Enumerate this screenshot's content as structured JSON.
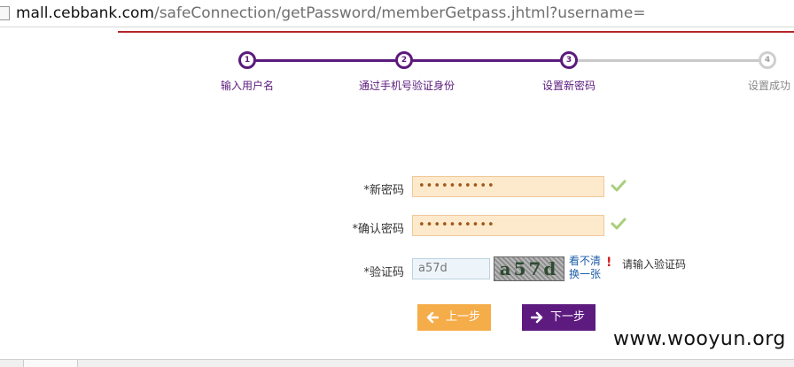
{
  "browser": {
    "url_domain": "mall.cebbank.com",
    "url_path": "/safeConnection/getPassword/memberGetpass.jhtml?username="
  },
  "steps": [
    {
      "number": "1",
      "label": "输入用户名",
      "state": "done"
    },
    {
      "number": "2",
      "label": "通过手机号验证身份",
      "state": "done"
    },
    {
      "number": "3",
      "label": "设置新密码",
      "state": "current"
    },
    {
      "number": "4",
      "label": "设置成功",
      "state": "todo"
    }
  ],
  "form": {
    "new_password_label": "*新密码",
    "new_password_value": "••••••••••",
    "confirm_password_label": "*确认密码",
    "confirm_password_value": "••••••••••",
    "captcha_label": "*验证码",
    "captcha_value": "a57d",
    "captcha_image_text": "a57d",
    "refresh_link": [
      "看不清",
      "换一张"
    ],
    "captcha_hint": "请输入验证码"
  },
  "buttons": {
    "prev_label": "上一步",
    "next_label": "下一步"
  },
  "watermark": "www.wooyun.org",
  "colors": {
    "primary": "#5d1a7f",
    "secondary_button": "#f5ad4a",
    "field_bg": "#fde9cc",
    "check": "#a8cf7a",
    "accent_rule": "#b4262a"
  }
}
